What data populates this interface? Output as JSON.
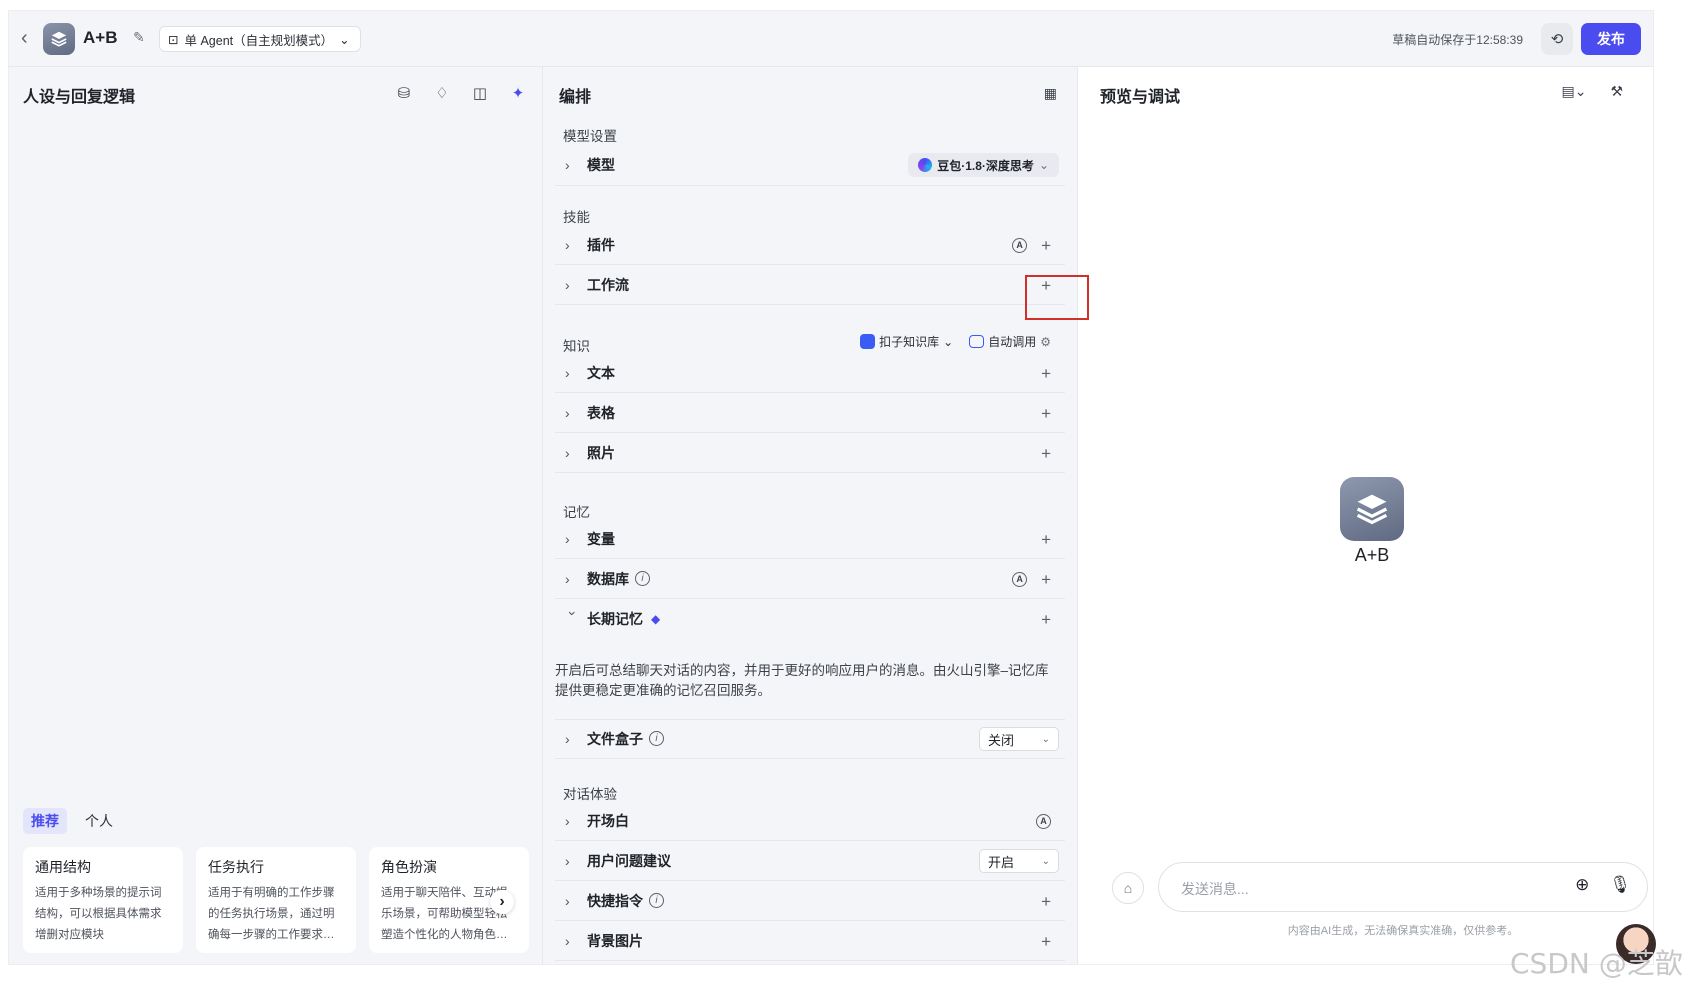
{
  "header": {
    "agent_name": "A+B",
    "mode_label": "单 Agent（自主规划模式）",
    "saved_text": "草稿自动保存于12:58:39",
    "publish_label": "发布"
  },
  "left_panel": {
    "title": "人设与回复逻辑",
    "tabs": [
      "推荐",
      "个人"
    ],
    "cards": [
      {
        "title": "通用结构",
        "desc": "适用于多种场景的提示词结构，可以根据具体需求增删对应模块"
      },
      {
        "title": "任务执行",
        "desc": "适用于有明确的工作步骤的任务执行场景，通过明确每一步骤的工作要求…"
      },
      {
        "title": "角色扮演",
        "desc": "适用于聊天陪伴、互动娱乐场景，可帮助模型轻松塑造个性化的人物角色…"
      }
    ]
  },
  "middle_panel": {
    "title": "编排",
    "sections": {
      "model_settings": "模型设置",
      "skills": "技能",
      "knowledge": "知识",
      "memory": "记忆",
      "dialog": "对话体验"
    },
    "rows": {
      "model": "模型",
      "model_value": "豆包·1.8·深度思考",
      "plugin": "插件",
      "workflow": "工作流",
      "text": "文本",
      "table": "表格",
      "photo": "照片",
      "variable": "变量",
      "database": "数据库",
      "long_memory": "长期记忆",
      "long_memory_desc": "开启后可总结聊天对话的内容，并用于更好的响应用户的消息。由火山引擎–记忆库提供更稳定更准确的记忆召回服务。",
      "file_box": "文件盒子",
      "file_box_value": "关闭",
      "opening": "开场白",
      "suggestion": "用户问题建议",
      "suggestion_value": "开启",
      "shortcut": "快捷指令",
      "background": "背景图片"
    },
    "knowledge_source": "扣子知识库",
    "auto_call": "自动调用"
  },
  "right_panel": {
    "title": "预览与调试",
    "bot_name": "A+B",
    "input_placeholder": "发送消息...",
    "disclaimer": "内容由AI生成，无法确保真实准确，仅供参考。"
  },
  "watermark": "CSDN @芝歆",
  "colors": {
    "accent": "#4b4cf0",
    "highlight": "#d1302a",
    "background": "#f4f5f8"
  },
  "icons": [
    "back-icon",
    "edit-icon",
    "history-icon",
    "grid-icon",
    "plus-icon",
    "chevron-right-icon",
    "chevron-down-icon",
    "info-icon",
    "auto-icon",
    "microphone-icon",
    "add-circle-icon",
    "clear-context-icon",
    "settings-icon"
  ]
}
